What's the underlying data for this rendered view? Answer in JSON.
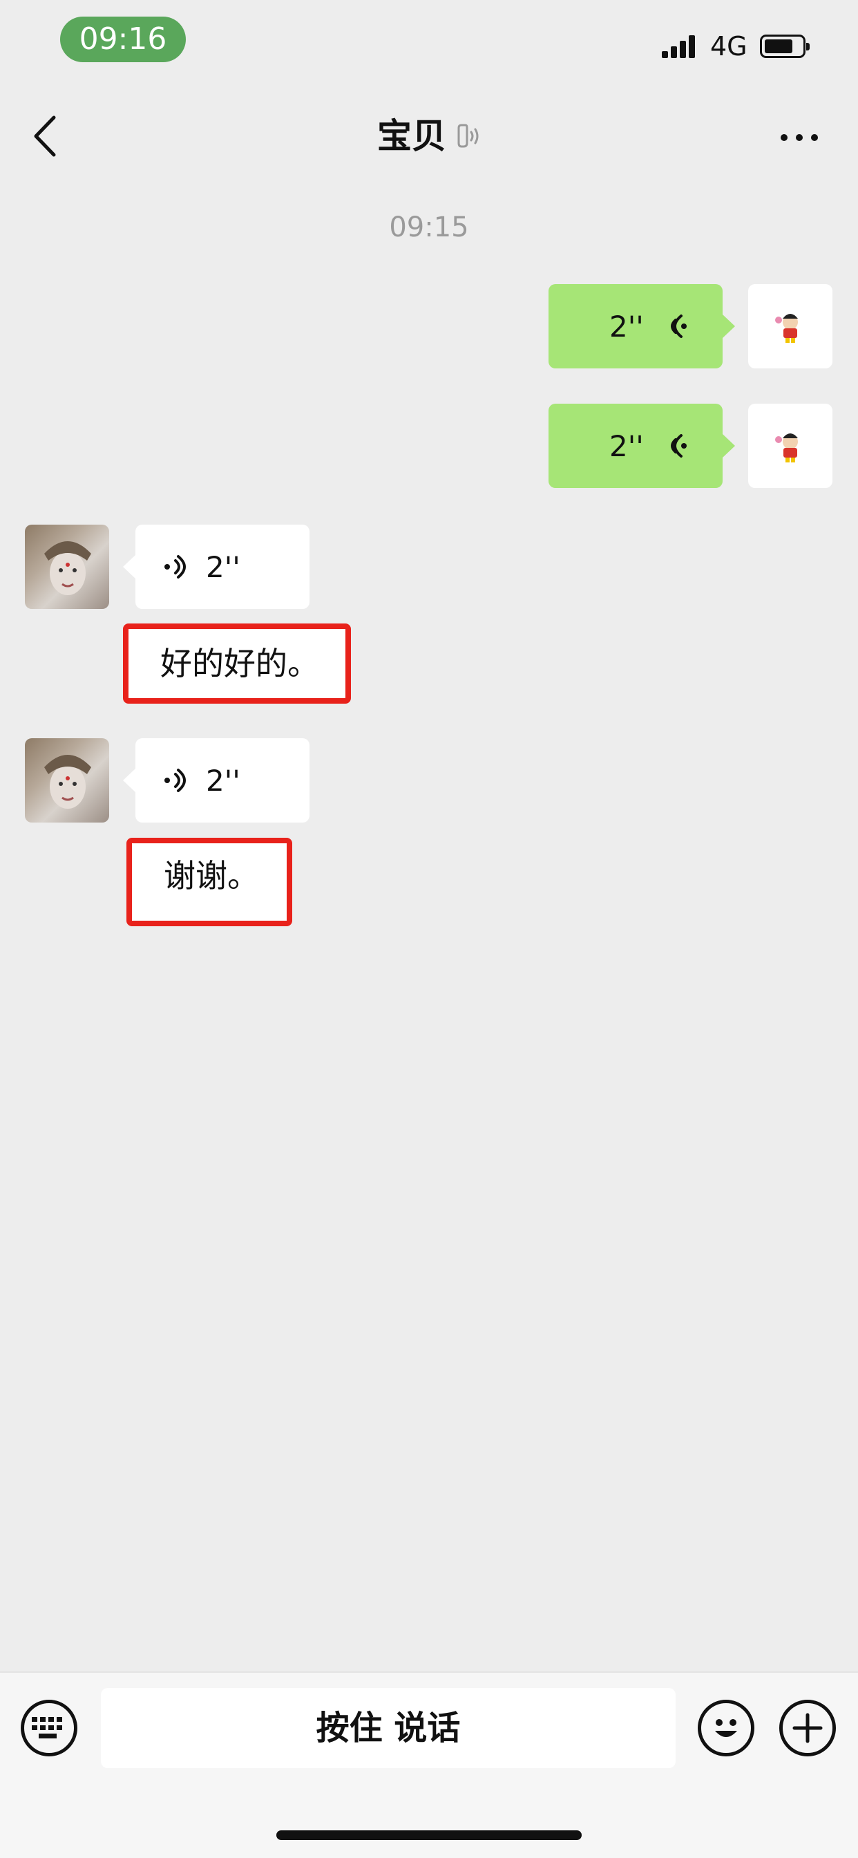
{
  "status_bar": {
    "time": "09:16",
    "network": "4G"
  },
  "nav": {
    "title": "宝贝",
    "back_icon": "chevron-left-icon",
    "more_icon": "ellipsis-icon"
  },
  "chat": {
    "timestamp": "09:15",
    "outgoing": [
      {
        "duration": "2''"
      },
      {
        "duration": "2''"
      }
    ],
    "incoming": [
      {
        "duration": "2''",
        "transcript": "好的好的。"
      },
      {
        "duration": "2''",
        "transcript": "谢谢。"
      }
    ]
  },
  "input_bar": {
    "hold_to_talk": "按住 说话",
    "keyboard_icon": "keyboard-icon",
    "emoji_icon": "emoji-icon",
    "plus_icon": "plus-icon"
  },
  "colors": {
    "outgoing_bubble": "#a6e576",
    "highlight_box": "#e8221b",
    "status_pill": "#5aa75b"
  }
}
